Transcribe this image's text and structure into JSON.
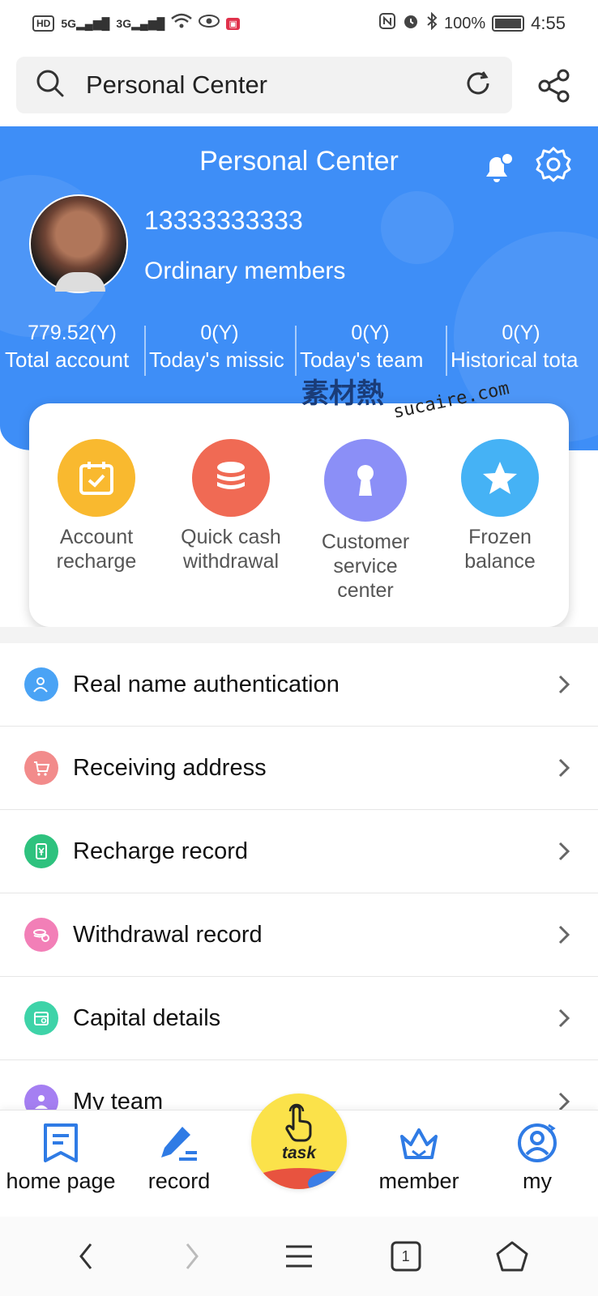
{
  "status_bar": {
    "left_chips": [
      "HD",
      "5G",
      "3G"
    ],
    "battery": "100%",
    "time": "4:55"
  },
  "browser": {
    "search_text": "Personal Center",
    "search_icon": "search-icon",
    "reload_icon": "reload-icon",
    "share_icon": "share-icon"
  },
  "header": {
    "title": "Personal Center",
    "user_id": "13333333333",
    "user_level": "Ordinary members",
    "stats": [
      {
        "value": "779.52(Y)",
        "label": "Total account"
      },
      {
        "value": "0(Y)",
        "label": "Today's missic"
      },
      {
        "value": "0(Y)",
        "label": "Today's team"
      },
      {
        "value": "0(Y)",
        "label": "Historical tota"
      }
    ]
  },
  "watermark": {
    "cn": "素材熱",
    "en": "sucaire.com"
  },
  "quick_actions": [
    {
      "label": "Account recharge",
      "icon": "calendar-check-icon",
      "color": "#f9b92f"
    },
    {
      "label": "Quick cash withdrawal",
      "icon": "coin-stack-icon",
      "color": "#f06a54"
    },
    {
      "label": "Customer service center",
      "icon": "keyhole-icon",
      "color": "#8b8ff7"
    },
    {
      "label": "Frozen balance",
      "icon": "star-icon",
      "color": "#45b2f5"
    }
  ],
  "menu": [
    {
      "label": "Real name authentication",
      "icon": "user-verify-icon",
      "color": "#4aa3f5"
    },
    {
      "label": "Receiving address",
      "icon": "cart-icon",
      "color": "#f28b8b"
    },
    {
      "label": "Recharge record",
      "icon": "yen-wallet-icon",
      "color": "#2ec27e"
    },
    {
      "label": "Withdrawal record",
      "icon": "coins-icon",
      "color": "#f27fb7"
    },
    {
      "label": "Capital details",
      "icon": "calendar-details-icon",
      "color": "#3ed3a8"
    },
    {
      "label": "My team",
      "icon": "team-icon",
      "color": "#a57ff2"
    }
  ],
  "tabbar": {
    "tabs": [
      {
        "label": "home page",
        "icon": "bookmark-icon"
      },
      {
        "label": "record",
        "icon": "pencil-icon"
      },
      {
        "label": "member",
        "icon": "crown-icon"
      },
      {
        "label": "my",
        "icon": "user-circle-icon"
      }
    ],
    "center": {
      "label": "task",
      "icon": "tap-hand-icon"
    }
  },
  "navbar": {
    "tab_count": "1"
  },
  "colors": {
    "primary": "#3e8ef7",
    "icon_blue": "#2f7be5"
  }
}
